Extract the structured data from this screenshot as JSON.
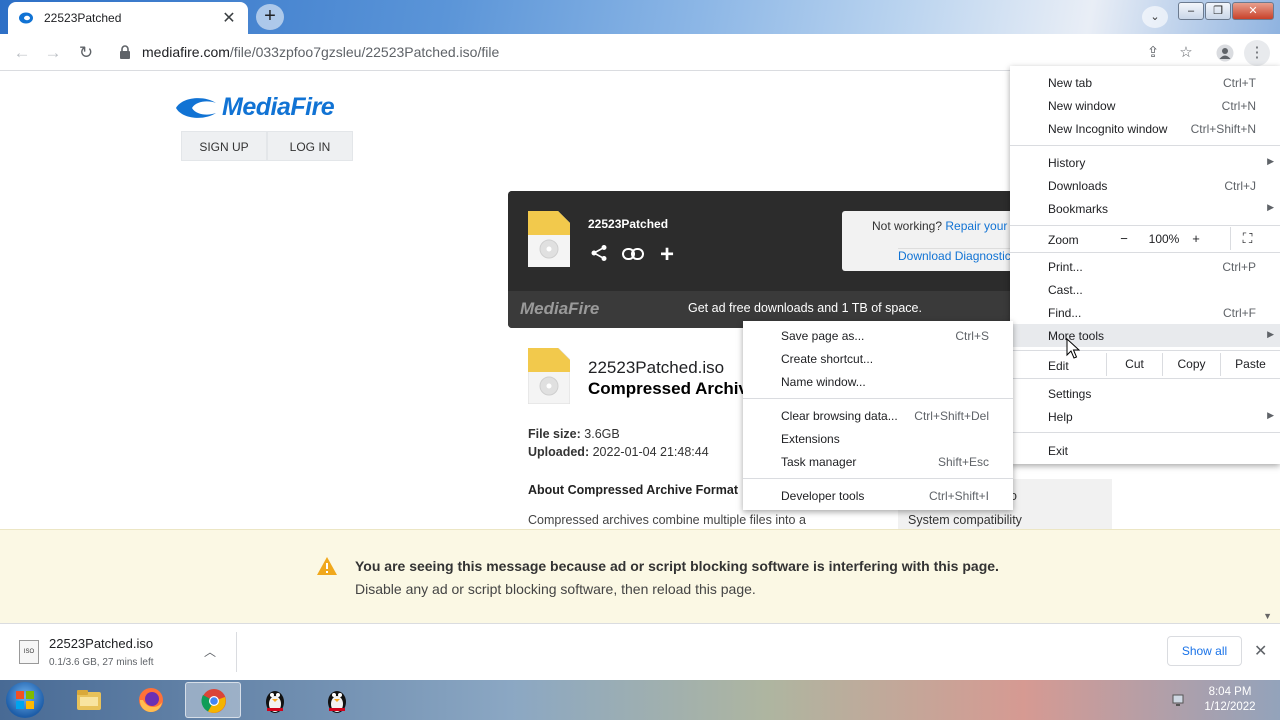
{
  "browser": {
    "tab_title": "22523Patched",
    "url_host": "mediafire.com",
    "url_path": "/file/033zpfoo7gzsleu/22523Patched.iso/file"
  },
  "page": {
    "logo_text": "MediaFire",
    "sign_up": "SIGN UP",
    "log_in": "LOG IN",
    "card_filename": "22523Patched",
    "help_text": "Not working?",
    "help_link": "Repair your",
    "help_diag": "Download Diagnostic",
    "card_logo": "MediaFire",
    "card_promo": "Get ad free downloads and 1 TB of space.",
    "file_title": "22523Patched.iso",
    "file_type": "Compressed Archive",
    "file_size_label": "File size:",
    "file_size": "3.6GB",
    "uploaded_label": "Uploaded:",
    "uploaded": "2022-01-04 21:48:44",
    "about_heading": "About Compressed Archive Format",
    "about_text": "Compressed archives combine multiple files into a",
    "side_partial": "o",
    "system_compat": "System compatibility"
  },
  "adblock": {
    "title": "You are seeing this message because ad or script blocking software is interfering with this page.",
    "subtitle": "Disable any ad or script blocking software, then reload this page."
  },
  "download_shelf": {
    "filename": "22523Patched.iso",
    "status": "0.1/3.6 GB, 27 mins left",
    "icon_text": "ISO",
    "show_all": "Show all"
  },
  "taskbar": {
    "time": "8:04 PM",
    "date": "1/12/2022"
  },
  "chrome_menu": {
    "new_tab": {
      "label": "New tab",
      "shortcut": "Ctrl+T"
    },
    "new_window": {
      "label": "New window",
      "shortcut": "Ctrl+N"
    },
    "incognito": {
      "label": "New Incognito window",
      "shortcut": "Ctrl+Shift+N"
    },
    "history": {
      "label": "History"
    },
    "downloads": {
      "label": "Downloads",
      "shortcut": "Ctrl+J"
    },
    "bookmarks": {
      "label": "Bookmarks"
    },
    "zoom": {
      "label": "Zoom",
      "minus": "−",
      "value": "100%",
      "plus": "+"
    },
    "print": {
      "label": "Print...",
      "shortcut": "Ctrl+P"
    },
    "cast": {
      "label": "Cast..."
    },
    "find": {
      "label": "Find...",
      "shortcut": "Ctrl+F"
    },
    "more_tools": {
      "label": "More tools"
    },
    "edit": {
      "label": "Edit",
      "cut": "Cut",
      "copy": "Copy",
      "paste": "Paste"
    },
    "settings": {
      "label": "Settings"
    },
    "help": {
      "label": "Help"
    },
    "exit": {
      "label": "Exit"
    }
  },
  "more_tools_menu": {
    "save_page": {
      "label": "Save page as...",
      "shortcut": "Ctrl+S"
    },
    "create_shortcut": {
      "label": "Create shortcut..."
    },
    "name_window": {
      "label": "Name window..."
    },
    "clear_data": {
      "label": "Clear browsing data...",
      "shortcut": "Ctrl+Shift+Del"
    },
    "extensions": {
      "label": "Extensions"
    },
    "task_manager": {
      "label": "Task manager",
      "shortcut": "Shift+Esc"
    },
    "dev_tools": {
      "label": "Developer tools",
      "shortcut": "Ctrl+Shift+I"
    }
  },
  "colors": {
    "mediafire_blue": "#1173d4",
    "chrome_link": "#1a73e8",
    "warning_bg": "#fbf8e4",
    "card_dark": "#2c2c2c"
  },
  "icons": [
    "mediafire-favicon",
    "close-icon",
    "plus-icon",
    "chevron-down-icon",
    "back-icon",
    "forward-icon",
    "reload-icon",
    "lock-icon",
    "share-icon",
    "star-icon",
    "profile-icon",
    "kebab-menu-icon",
    "link-icon",
    "warning-icon",
    "iso-file-icon",
    "windows-start-icon",
    "explorer-icon",
    "firefox-icon",
    "chrome-icon",
    "penguin-icon",
    "fullscreen-icon",
    "submenu-arrow-icon",
    "mouse-cursor"
  ]
}
